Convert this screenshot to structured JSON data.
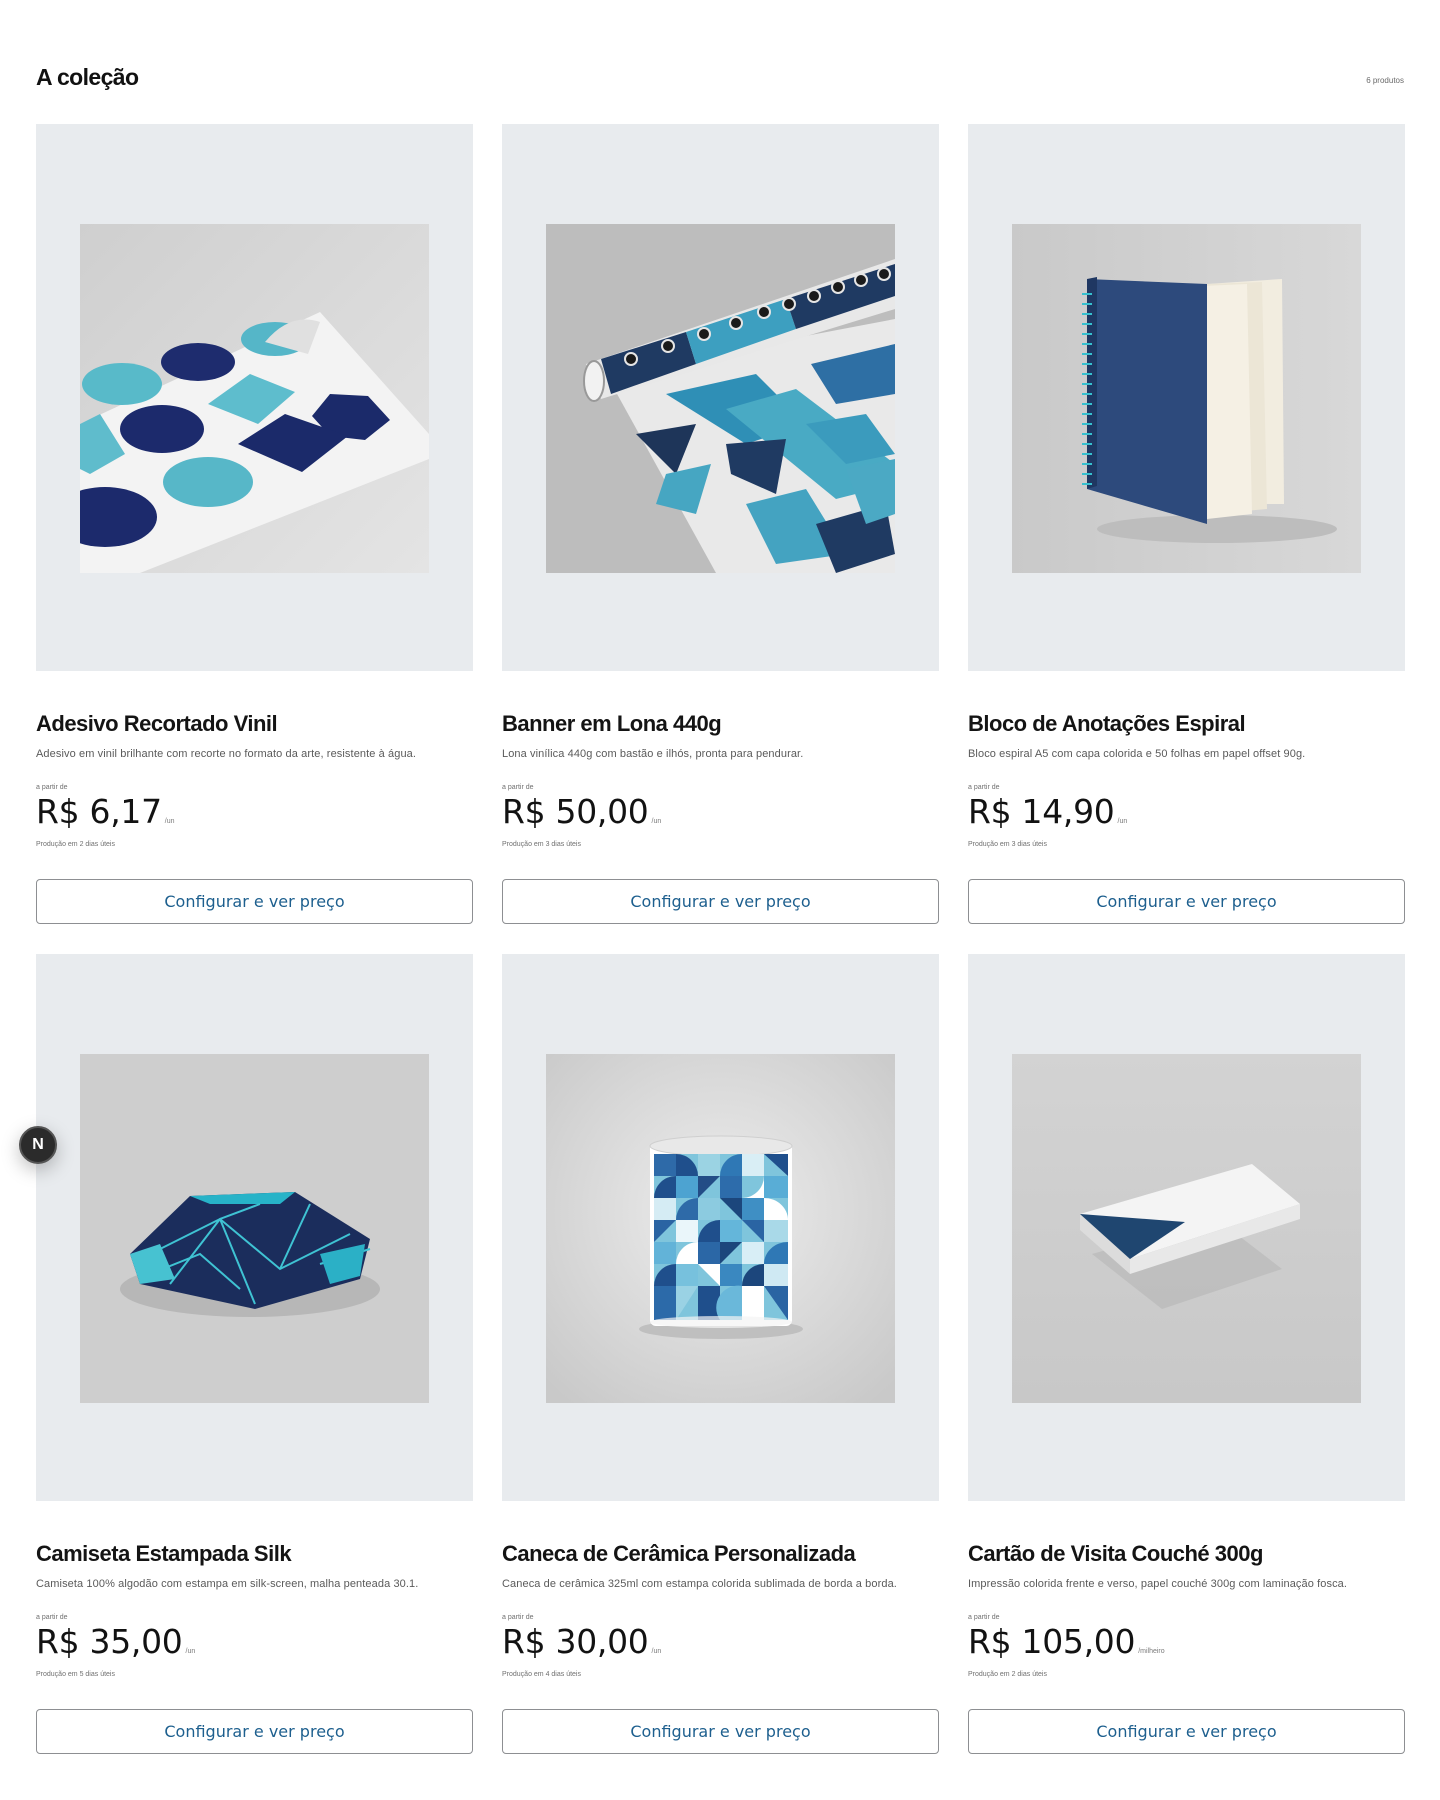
{
  "collection": {
    "title": "A coleção",
    "count": "6 produtos"
  },
  "products": [
    {
      "name": "Adesivo Recortado Vinil",
      "description": "Adesivo em vinil brilhante com recorte no formato da arte, resistente à água.",
      "from_label": "a partir de",
      "price": "R$ 6,17",
      "unit": "/un",
      "production": "Produção em 2 dias úteis",
      "cta": "Configurar e ver preço",
      "image": "vinyl-stickers"
    },
    {
      "name": "Banner em Lona 440g",
      "description": "Lona vinílica 440g com bastão e ilhós, pronta para pendurar.",
      "from_label": "a partir de",
      "price": "R$ 50,00",
      "unit": "/un",
      "production": "Produção em 3 dias úteis",
      "cta": "Configurar e ver preço",
      "image": "rolled-banner"
    },
    {
      "name": "Bloco de Anotações Espiral",
      "description": "Bloco espiral A5 com capa colorida e 50 folhas em papel offset 90g.",
      "from_label": "a partir de",
      "price": "R$ 14,90",
      "unit": "/un",
      "production": "Produção em 3 dias úteis",
      "cta": "Configurar e ver preço",
      "image": "spiral-notebook"
    },
    {
      "name": "Camiseta Estampada Silk",
      "description": "Camiseta 100% algodão com estampa em silk-screen, malha penteada 30.1.",
      "from_label": "a partir de",
      "price": "R$ 35,00",
      "unit": "/un",
      "production": "Produção em 5 dias úteis",
      "cta": "Configurar e ver preço",
      "image": "folded-tshirt"
    },
    {
      "name": "Caneca de Cerâmica Personalizada",
      "description": "Caneca de cerâmica 325ml com estampa colorida sublimada de borda a borda.",
      "from_label": "a partir de",
      "price": "R$ 30,00",
      "unit": "/un",
      "production": "Produção em 4 dias úteis",
      "cta": "Configurar e ver preço",
      "image": "ceramic-mug"
    },
    {
      "name": "Cartão de Visita Couché 300g",
      "description": "Impressão colorida frente e verso, papel couché 300g com laminação fosca.",
      "from_label": "a partir de",
      "price": "R$ 105,00",
      "unit": "/milheiro",
      "production": "Produção em 2 dias úteis",
      "cta": "Configurar e ver preço",
      "image": "business-cards"
    }
  ],
  "fab": {
    "label": "N",
    "icon": "nextjs-icon"
  },
  "colors": {
    "panel": "#e8ebee",
    "accent": "#1d5f8e",
    "navy": "#1f3f6b",
    "teal": "#4fb3c9"
  }
}
